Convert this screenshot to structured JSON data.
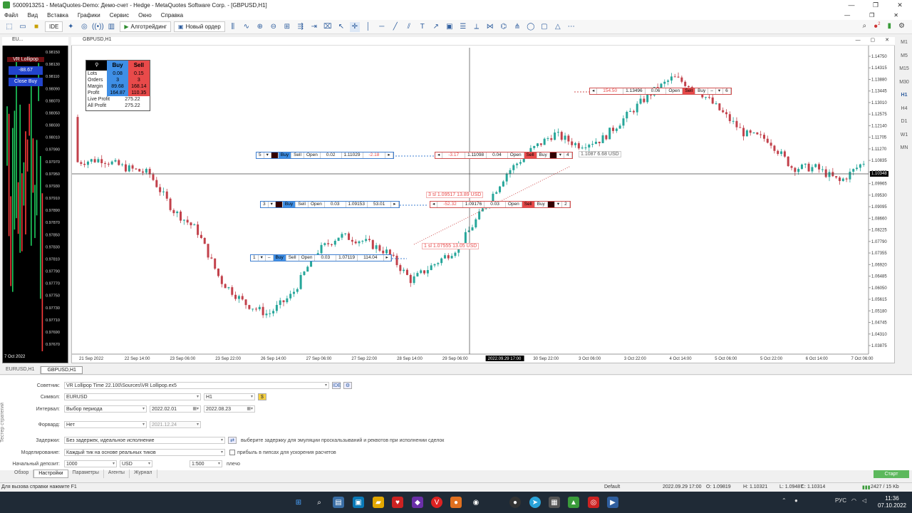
{
  "window": {
    "title": "5000913251 - MetaQuotes-Demo: Демо-счет - Hedge - MetaQuotes Software Corp. - [GBPUSD,H1]",
    "controls": [
      "—",
      "❐",
      "✕"
    ]
  },
  "menu": {
    "items": [
      "Файл",
      "Вид",
      "Вставка",
      "Графики",
      "Сервис",
      "Окно",
      "Справка"
    ],
    "right": [
      "—",
      "❐",
      "✕"
    ]
  },
  "toolbar": {
    "ide": "IDE",
    "algotrading": "Алготрейдинг",
    "new_order": "Новый ордер",
    "notification_count": "2"
  },
  "left_chart": {
    "tab": "EU...",
    "ea_name": "VR Lollipop",
    "profit": "-88.67",
    "close_button": "Close Buy",
    "date_label": "7 Oct 2022",
    "prices": [
      "0.98150",
      "0.98130",
      "0.98110",
      "0.98090",
      "0.98070",
      "0.98050",
      "0.98030",
      "0.98010",
      "0.97990",
      "0.97970",
      "0.97950",
      "0.97930",
      "0.97910",
      "0.97890",
      "0.97870",
      "0.97850",
      "0.97830",
      "0.97810",
      "0.97790",
      "0.97770",
      "0.97750",
      "0.97730",
      "0.97710",
      "0.97690",
      "0.97670"
    ]
  },
  "main_chart": {
    "tab": "GBPUSD,H1",
    "current_price": "1.10348",
    "price_axis": [
      "1.14750",
      "1.14315",
      "1.13880",
      "1.13445",
      "1.13010",
      "1.12575",
      "1.12140",
      "1.11705",
      "1.11270",
      "1.10835",
      "1.10400",
      "1.09965",
      "1.09530",
      "1.09095",
      "1.08660",
      "1.08225",
      "1.07790",
      "1.07355",
      "1.06920",
      "1.06485",
      "1.06050",
      "1.05615",
      "1.05180",
      "1.04745",
      "1.04310",
      "1.03875"
    ],
    "time_axis": [
      "21 Sep 2022",
      "22 Sep 14:00",
      "23 Sep 06:00",
      "23 Sep 22:00",
      "26 Sep 14:00",
      "27 Sep 06:00",
      "27 Sep 22:00",
      "28 Sep 14:00",
      "29 Sep 06:00",
      "2022.09.29 17:00",
      "30 Sep 22:00",
      "3 Oct 06:00",
      "3 Oct 22:00",
      "4 Oct 14:00",
      "5 Oct 06:00",
      "5 Oct 22:00",
      "6 Oct 14:00",
      "7 Oct 06:00"
    ],
    "crosshair_time": "2022.09.29 17:00"
  },
  "panel": {
    "buy": "Buy",
    "sell": "Sell",
    "rows": [
      {
        "k": "Lots",
        "b": "0.08",
        "s": "0.15"
      },
      {
        "k": "Orders",
        "b": "3",
        "s": "3"
      },
      {
        "k": "Margin",
        "b": "89.68",
        "s": "168.14"
      },
      {
        "k": "Profit",
        "b": "164.87",
        "s": "110.35"
      }
    ],
    "live_profit_label": "Live Profit",
    "live_profit": "275.22",
    "all_profit_label": "All Profit",
    "all_profit": "275.22"
  },
  "orders": [
    {
      "n": "5",
      "lots": "0.02",
      "price": "1.11029",
      "pnl": "-2.18"
    },
    {
      "n": "3",
      "lots": "0.03",
      "price": "1.09153",
      "pnl": "53.01"
    },
    {
      "n": "1",
      "lots": "0.03",
      "price": "1.07119",
      "pnl": "114.04"
    }
  ],
  "sell_orders": [
    {
      "n": "4",
      "pnl": "-3.17",
      "price": "1.11098",
      "lots": "0.04"
    },
    {
      "n": "2",
      "pnl": "-52.32",
      "price": "1.09176",
      "lots": "0.03"
    },
    {
      "n": "6",
      "pnl": "154.50",
      "price": "1.13496",
      "lots": "0.06"
    }
  ],
  "order_labels": {
    "buy": "Buy",
    "sell": "Sell",
    "open": "Open"
  },
  "chart_labels": {
    "tp": "1.1087 6.68 USD",
    "sl3": "3 sl 1.09517 13.89 USD",
    "sl1": "1 sl 1.07555 13.05 USD"
  },
  "chart_tabs": [
    "EURUSD,H1",
    "GBPUSD,H1"
  ],
  "tester": {
    "side_label": "Тестер стратегий",
    "expert_label": "Советник:",
    "expert_value": "VR Lollipop Time 22.100\\Sources\\VR Lollipop.ex5",
    "symbol_label": "Символ:",
    "symbol_value": "EURUSD",
    "period_value": "H1",
    "interval_label": "Интервал:",
    "interval_value": "Выбор периода",
    "date_from": "2022.02.01",
    "date_to": "2022.08.23",
    "forward_label": "Форвард:",
    "forward_value": "Нет",
    "forward_date": "2021.12.24",
    "delays_label": "Задержки:",
    "delays_value": "Без задержек, идеальное исполнение",
    "delays_note": "выберите задержку для эмуляции проскальзываний и реквотов при исполнении сделок",
    "modeling_label": "Моделирование:",
    "modeling_value": "Каждый тик на основе реальных тиков",
    "pips_note": "прибыль в пипсах для ускорения расчетов",
    "deposit_label": "Начальный депозит:",
    "deposit_value": "1000",
    "currency_value": "USD",
    "leverage_value": "1:500",
    "leverage_label": "плечо",
    "tabs": [
      "Обзор",
      "Настройки",
      "Параметры",
      "Агенты",
      "Журнал"
    ],
    "start": "Старт"
  },
  "status": {
    "help": "Для вызова справки нажмите F1",
    "profile": "Default",
    "time": "2022.09.29 17:00",
    "open": "O: 1.09819",
    "high": "H: 1.10321",
    "low": "L: 1.09487",
    "close": "C: 1.10314",
    "traffic": "2427 / 15 Kb"
  },
  "taskbar": {
    "lang": "РУС",
    "time": "11:36",
    "date": "07.10.2022"
  },
  "timeframes": [
    "M1",
    "M5",
    "M15",
    "M30",
    "H1",
    "H4",
    "D1",
    "W1",
    "MN"
  ],
  "colors": {
    "bull": "#26a69a",
    "bear": "#c2414b",
    "buy": "#3f8fe6",
    "sell": "#e84a4a",
    "start": "#5cb85c"
  }
}
